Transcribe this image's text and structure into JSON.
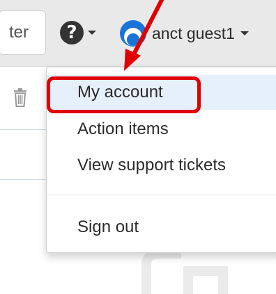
{
  "header": {
    "filter_visible_text": "ter",
    "user_name": "anct guest1"
  },
  "icons": {
    "help": "question-circle-icon",
    "user_avatar": "user-avatar-icon",
    "help_caret": "caret-down-icon",
    "user_caret": "caret-down-icon",
    "trash": "trash-icon"
  },
  "user_menu": {
    "items": [
      {
        "label": "My account",
        "active": true
      },
      {
        "label": "Action items",
        "active": false
      },
      {
        "label": "View support tickets",
        "active": false
      },
      {
        "label": "Sign out",
        "active": false
      }
    ]
  },
  "annotations": {
    "highlight_color": "#e10000",
    "arrow_color": "#e10000"
  },
  "colors": {
    "topbar_bg": "#e9e9e9",
    "active_item_bg": "#e6f0fb",
    "avatar_blue": "#1a73d9"
  }
}
